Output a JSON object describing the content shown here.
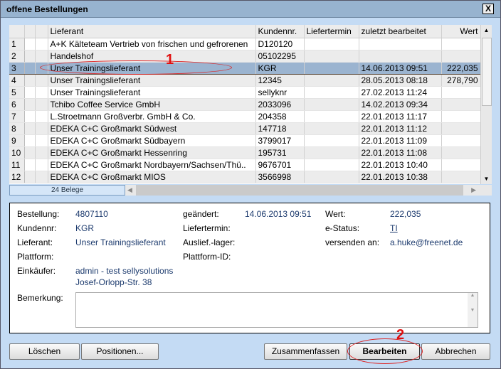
{
  "title": "offene Bestellungen",
  "close_label": "X",
  "table": {
    "headers": [
      "",
      "",
      "",
      "Lieferant",
      "Kundennr.",
      "Liefertermin",
      "zuletzt bearbeitet",
      "Wert"
    ],
    "rows": [
      [
        "1",
        "A+K Kälteteam Vertrieb von frischen und gefrorenen",
        "D120120",
        "",
        "",
        ""
      ],
      [
        "2",
        "Handelshof",
        "05102295",
        "",
        "",
        ""
      ],
      [
        "3",
        "Unser Trainingslieferant",
        "KGR",
        "",
        "14.06.2013 09:51",
        "222,035"
      ],
      [
        "4",
        "Unser Trainingslieferant",
        "12345",
        "",
        "28.05.2013 08:18",
        "278,790"
      ],
      [
        "5",
        "Unser Trainingslieferant",
        "sellyknr",
        "",
        "27.02.2013 11:24",
        ""
      ],
      [
        "6",
        "Tchibo Coffee Service GmbH",
        "2033096",
        "",
        "14.02.2013 09:34",
        ""
      ],
      [
        "7",
        "L.Stroetmann Großverbr. GmbH & Co.",
        "204358",
        "",
        "22.01.2013 11:17",
        ""
      ],
      [
        "8",
        "EDEKA C+C Großmarkt Südwest",
        "147718",
        "",
        "22.01.2013 11:12",
        ""
      ],
      [
        "9",
        "EDEKA C+C Großmarkt Südbayern",
        "3799017",
        "",
        "22.01.2013 11:09",
        ""
      ],
      [
        "10",
        "EDEKA C+C Großmarkt Hessenring",
        "195731",
        "",
        "22.01.2013 11:08",
        ""
      ],
      [
        "11",
        "EDEKA C+C Großmarkt Nordbayern/Sachsen/Thü..",
        "9676701",
        "",
        "22.01.2013 10:40",
        ""
      ],
      [
        "12",
        "EDEKA C+C Großmarkt MIOS",
        "3566998",
        "",
        "22.01.2013 10:38",
        ""
      ]
    ],
    "selected_index": 2,
    "count_label": "24 Belege"
  },
  "details": {
    "bestellung_label": "Bestellung:",
    "bestellung": "4807110",
    "geaendert_label": "geändert:",
    "geaendert": "14.06.2013 09:51",
    "wert_label": "Wert:",
    "wert": "222,035",
    "kundennr_label": "Kundennr:",
    "kundennr": "KGR",
    "liefertermin_label": "Liefertermin:",
    "estatus_label": "e-Status:",
    "estatus": "TI",
    "lieferant_label": "Lieferant:",
    "lieferant": "Unser Trainingslieferant",
    "lager_label": "Auslief.-lager:",
    "versenden_label": "versenden an:",
    "versenden": "a.huke@freenet.de",
    "plattform_label": "Plattform:",
    "plattform_id_label": "Plattform-ID:",
    "einkaeufer_label": "Einkäufer:",
    "einkaeufer": "admin - test sellysolutions",
    "adresse": "Josef-Orlopp-Str. 38",
    "bemerkung_label": "Bemerkung:"
  },
  "buttons": {
    "loeschen": "Löschen",
    "positionen": "Positionen...",
    "zusammenfassen": "Zusammenfassen",
    "bearbeiten": "Bearbeiten",
    "abbrechen": "Abbrechen"
  },
  "annotations": [
    "1",
    "2"
  ]
}
